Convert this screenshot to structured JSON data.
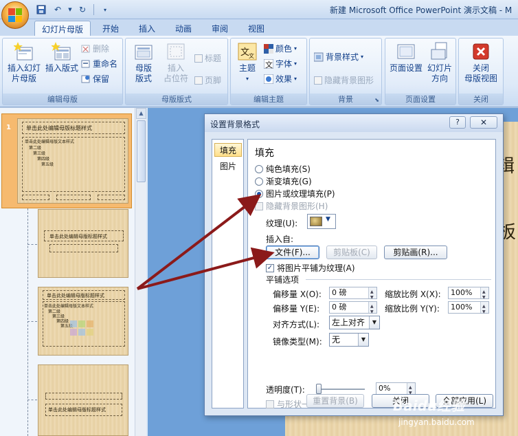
{
  "window": {
    "title": "新建 Microsoft Office PowerPoint 演示文稿 - M"
  },
  "tabs": [
    "幻灯片母版",
    "开始",
    "插入",
    "动画",
    "审阅",
    "视图"
  ],
  "ribbon": {
    "group_edit_master": {
      "label": "编辑母版",
      "insert_slide_master": "插入幻灯\n片母版",
      "insert_layout": "插入版式",
      "delete": "删除",
      "rename": "重命名",
      "preserve": "保留"
    },
    "group_master_layout": {
      "label": "母版版式",
      "master_layout": "母版\n版式",
      "insert_placeholder": "插入\n占位符",
      "title_check": "标题",
      "footer_check": "页脚"
    },
    "group_edit_theme": {
      "label": "编辑主题",
      "themes": "主题",
      "colors": "颜色",
      "fonts": "字体",
      "effects": "效果"
    },
    "group_background": {
      "label": "背景",
      "background_styles": "背景样式",
      "hide_background_graphics": "隐藏背景图形"
    },
    "group_page_setup": {
      "label": "页面设置",
      "page_setup": "页面设置",
      "slide_orientation": "幻灯片\n方向"
    },
    "group_close": {
      "label": "关闭",
      "close_master_view": "关闭\n母版视图"
    }
  },
  "thumbnails": {
    "slide_number": "1",
    "master_title": "单击此处编辑母版标题样式",
    "master_text": "单击此处编辑母版文本样式",
    "level2": "第二级",
    "level3": "第三级",
    "level4": "第四级",
    "level5": "第五级"
  },
  "slide_edge_chars": [
    "辑",
    "板"
  ],
  "dialog": {
    "title": "设置背景格式",
    "help": "?",
    "close": "✕",
    "categories": [
      "填充",
      "图片"
    ],
    "heading": "填充",
    "options": {
      "solid": "纯色填充(S)",
      "gradient": "渐变填充(G)",
      "picture_texture": "图片或纹理填充(P)",
      "hide_graphics": "隐藏背景图形(H)"
    },
    "texture_label": "纹理(U):",
    "insert_from": "插入自:",
    "file_button": "文件(F)...",
    "clipboard_button": "剪贴板(C)",
    "clipart_button": "剪贴画(R)...",
    "tile_checkbox": "将图片平铺为纹理(A)",
    "tiling_options": "平铺选项",
    "offset_x_label": "偏移量 X(O):",
    "offset_x_value": "0 磅",
    "offset_y_label": "偏移量 Y(E):",
    "offset_y_value": "0 磅",
    "scale_x_label": "缩放比例 X(X):",
    "scale_x_value": "100%",
    "scale_y_label": "缩放比例 Y(Y):",
    "scale_y_value": "100%",
    "alignment_label": "对齐方式(L):",
    "alignment_value": "左上对齐",
    "mirror_label": "镜像类型(M):",
    "mirror_value": "无",
    "transparency_label": "透明度(T):",
    "transparency_value": "0%",
    "rotate_with_shape": "与形状一起旋转(W)",
    "reset_button": "重置背景(B)",
    "close_button": "关闭",
    "apply_all_button": "全部应用(L)"
  },
  "watermark": {
    "brand": "Baidu经验",
    "url": "jingyan.baidu.com"
  },
  "colors": {
    "ribbon_text": "#15428b",
    "arrow": "#8b1a1a",
    "selected_thumb": "#f6ba6f"
  }
}
